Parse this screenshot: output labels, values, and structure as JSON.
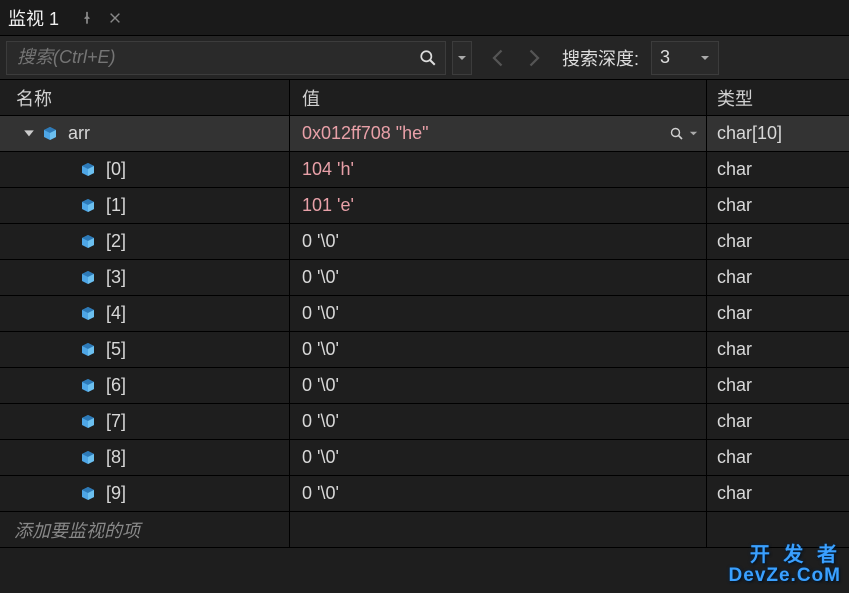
{
  "tab": {
    "title": "监视 1"
  },
  "toolbar": {
    "search_placeholder": "搜索(Ctrl+E)",
    "depth_label": "搜索深度:",
    "depth_value": "3"
  },
  "columns": {
    "name": "名称",
    "value": "值",
    "type": "类型"
  },
  "rows": [
    {
      "name": "arr",
      "value": "0x012ff708 \"he\"",
      "type": "char[10]",
      "indent": 0,
      "expanded": true,
      "selected": true,
      "pink": true,
      "hasSearch": true
    },
    {
      "name": "[0]",
      "value": "104 'h'",
      "type": "char",
      "indent": 1,
      "pink": true
    },
    {
      "name": "[1]",
      "value": "101 'e'",
      "type": "char",
      "indent": 1,
      "pink": true
    },
    {
      "name": "[2]",
      "value": "0 '\\0'",
      "type": "char",
      "indent": 1
    },
    {
      "name": "[3]",
      "value": "0 '\\0'",
      "type": "char",
      "indent": 1
    },
    {
      "name": "[4]",
      "value": "0 '\\0'",
      "type": "char",
      "indent": 1
    },
    {
      "name": "[5]",
      "value": "0 '\\0'",
      "type": "char",
      "indent": 1
    },
    {
      "name": "[6]",
      "value": "0 '\\0'",
      "type": "char",
      "indent": 1
    },
    {
      "name": "[7]",
      "value": "0 '\\0'",
      "type": "char",
      "indent": 1
    },
    {
      "name": "[8]",
      "value": "0 '\\0'",
      "type": "char",
      "indent": 1
    },
    {
      "name": "[9]",
      "value": "0 '\\0'",
      "type": "char",
      "indent": 1
    }
  ],
  "add_item_placeholder": "添加要监视的项",
  "watermark": {
    "line1": "开 发 者",
    "line2": "DevZe.CoM"
  }
}
